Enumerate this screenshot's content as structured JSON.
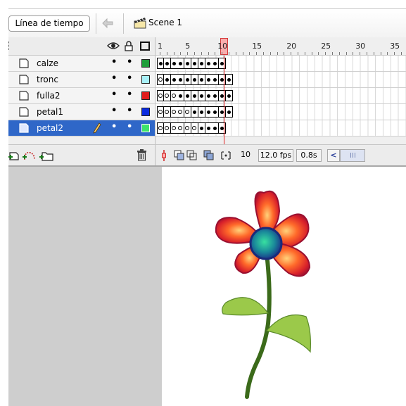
{
  "toolbar": {
    "timeline_tab": "Línea de tiempo",
    "scene_label": "Scene 1",
    "back_icon": "back-arrow-icon",
    "scene_icon": "clapperboard-icon"
  },
  "ruler": {
    "frame_numbers": [
      "1",
      "5",
      "10",
      "15",
      "20",
      "25",
      "30",
      "35"
    ],
    "current_frame": 10
  },
  "layers": [
    {
      "name": "calze",
      "color": "#1f9e3a",
      "selected": false,
      "keyframes": "ffffffffff"
    },
    {
      "name": "tronc",
      "color": "#a8f0f8",
      "selected": false,
      "keyframes": "offffffffff"
    },
    {
      "name": "fulla2",
      "color": "#e01c1c",
      "selected": false,
      "keyframes": "oooffffffff"
    },
    {
      "name": "petal1",
      "color": "#0a2be0",
      "selected": false,
      "keyframes": "oooooffffff"
    },
    {
      "name": "petal2",
      "color": "#3ee56a",
      "selected": true,
      "keyframes": "ooooooffff"
    }
  ],
  "status": {
    "current_frame": "10",
    "fps": "12.0 fps",
    "time": "0.8s"
  },
  "colors": {
    "selection": "#2f67c8",
    "playhead": "#e02020",
    "petal": "#d8262a",
    "center": "#1a8a9a",
    "stem": "#3b6a1a",
    "leaf": "#9bc94a"
  }
}
